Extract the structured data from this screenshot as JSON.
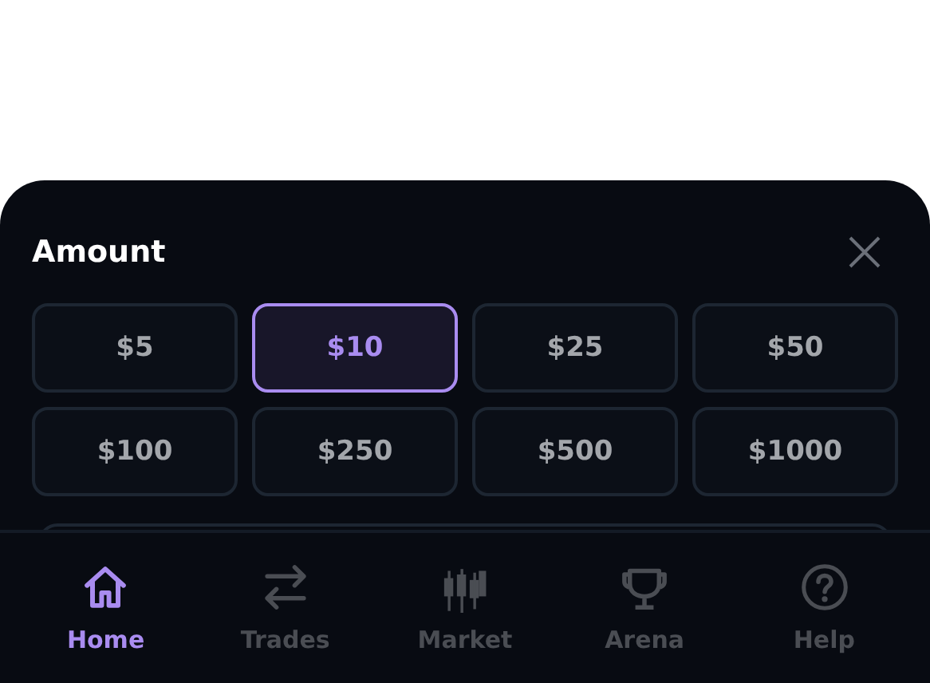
{
  "sheet": {
    "title": "Amount"
  },
  "amounts": [
    {
      "label": "$5",
      "selected": false
    },
    {
      "label": "$10",
      "selected": true
    },
    {
      "label": "$25",
      "selected": false
    },
    {
      "label": "$50",
      "selected": false
    },
    {
      "label": "$100",
      "selected": false
    },
    {
      "label": "$250",
      "selected": false
    },
    {
      "label": "$500",
      "selected": false
    },
    {
      "label": "$1000",
      "selected": false
    }
  ],
  "nav": [
    {
      "kind": "home",
      "label": "Home",
      "selected": true
    },
    {
      "kind": "trades",
      "label": "Trades",
      "selected": false
    },
    {
      "kind": "market",
      "label": "Market",
      "selected": false
    },
    {
      "kind": "arena",
      "label": "Arena",
      "selected": false
    },
    {
      "kind": "help",
      "label": "Help",
      "selected": false
    }
  ]
}
